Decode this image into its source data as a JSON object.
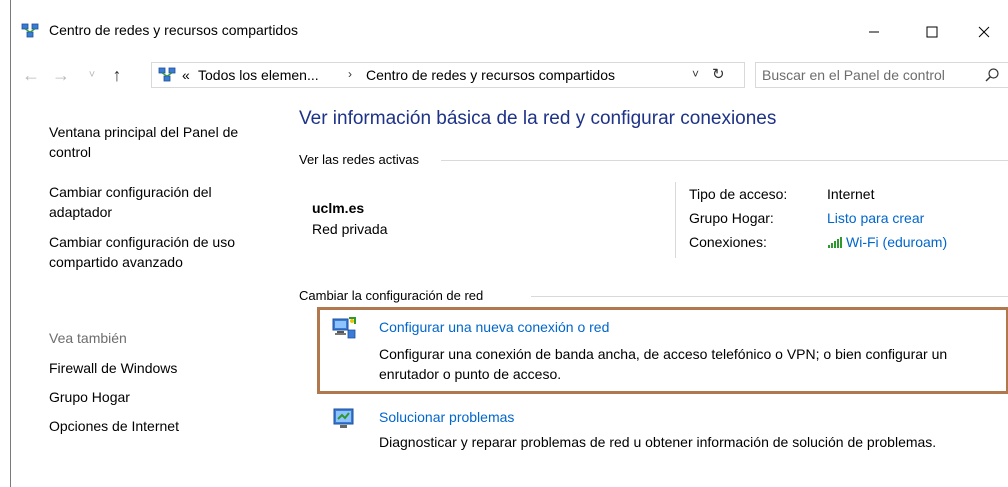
{
  "window": {
    "title": "Centro de redes y recursos compartidos",
    "minimize_glyph": "—",
    "maximize_glyph": "☐",
    "close_glyph": "✕"
  },
  "address": {
    "back_glyph": "←",
    "forward_glyph": "→",
    "recent_glyph": "˅",
    "up_glyph": "↑",
    "prefix": "«",
    "crumb1": "Todos los elemen...",
    "sep": "›",
    "crumb2": "Centro de redes y recursos compartidos",
    "dropdown_glyph": "˅",
    "refresh_glyph": "↻"
  },
  "search": {
    "placeholder": "Buscar en el Panel de control"
  },
  "sidebar": {
    "home_line1": "Ventana principal del Panel de",
    "home_line2": "control",
    "adapter_line1": "Cambiar configuración del",
    "adapter_line2": "adaptador",
    "sharing_line1": "Cambiar configuración de uso",
    "sharing_line2": "compartido avanzado",
    "see_also": "Vea también",
    "firewall": "Firewall de Windows",
    "homegroup": "Grupo Hogar",
    "internet_options": "Opciones de Internet"
  },
  "main": {
    "title": "Ver información básica de la red y configurar conexiones",
    "active_networks_heading": "Ver las redes activas",
    "network_name": "uclm.es",
    "network_type": "Red privada",
    "access_type_label": "Tipo de acceso:",
    "access_type_value": "Internet",
    "homegroup_label": "Grupo Hogar:",
    "homegroup_value": "Listo para crear",
    "connections_label": "Conexiones:",
    "connections_value": "Wi-Fi (eduroam)",
    "change_settings_heading": "Cambiar la configuración de red",
    "task1_title": "Configurar una nueva conexión o red",
    "task1_desc_line1": "Configurar una conexión de banda ancha, de acceso telefónico o VPN; o bien configurar un",
    "task1_desc_line2": "enrutador o punto de acceso.",
    "task2_title": "Solucionar problemas",
    "task2_desc": "Diagnosticar y reparar problemas de red u obtener información de solución de problemas."
  },
  "colors": {
    "title_blue": "#1e3287",
    "link_blue": "#0066cc",
    "highlight_border": "#b1784e",
    "wifi_green": "#2e9a2e"
  },
  "icons": {
    "title": "network-center-icon",
    "address": "network-center-icon",
    "search": "search-icon",
    "wifi": "wifi-signal-icon",
    "task1": "new-connection-icon",
    "task2": "troubleshoot-icon"
  }
}
